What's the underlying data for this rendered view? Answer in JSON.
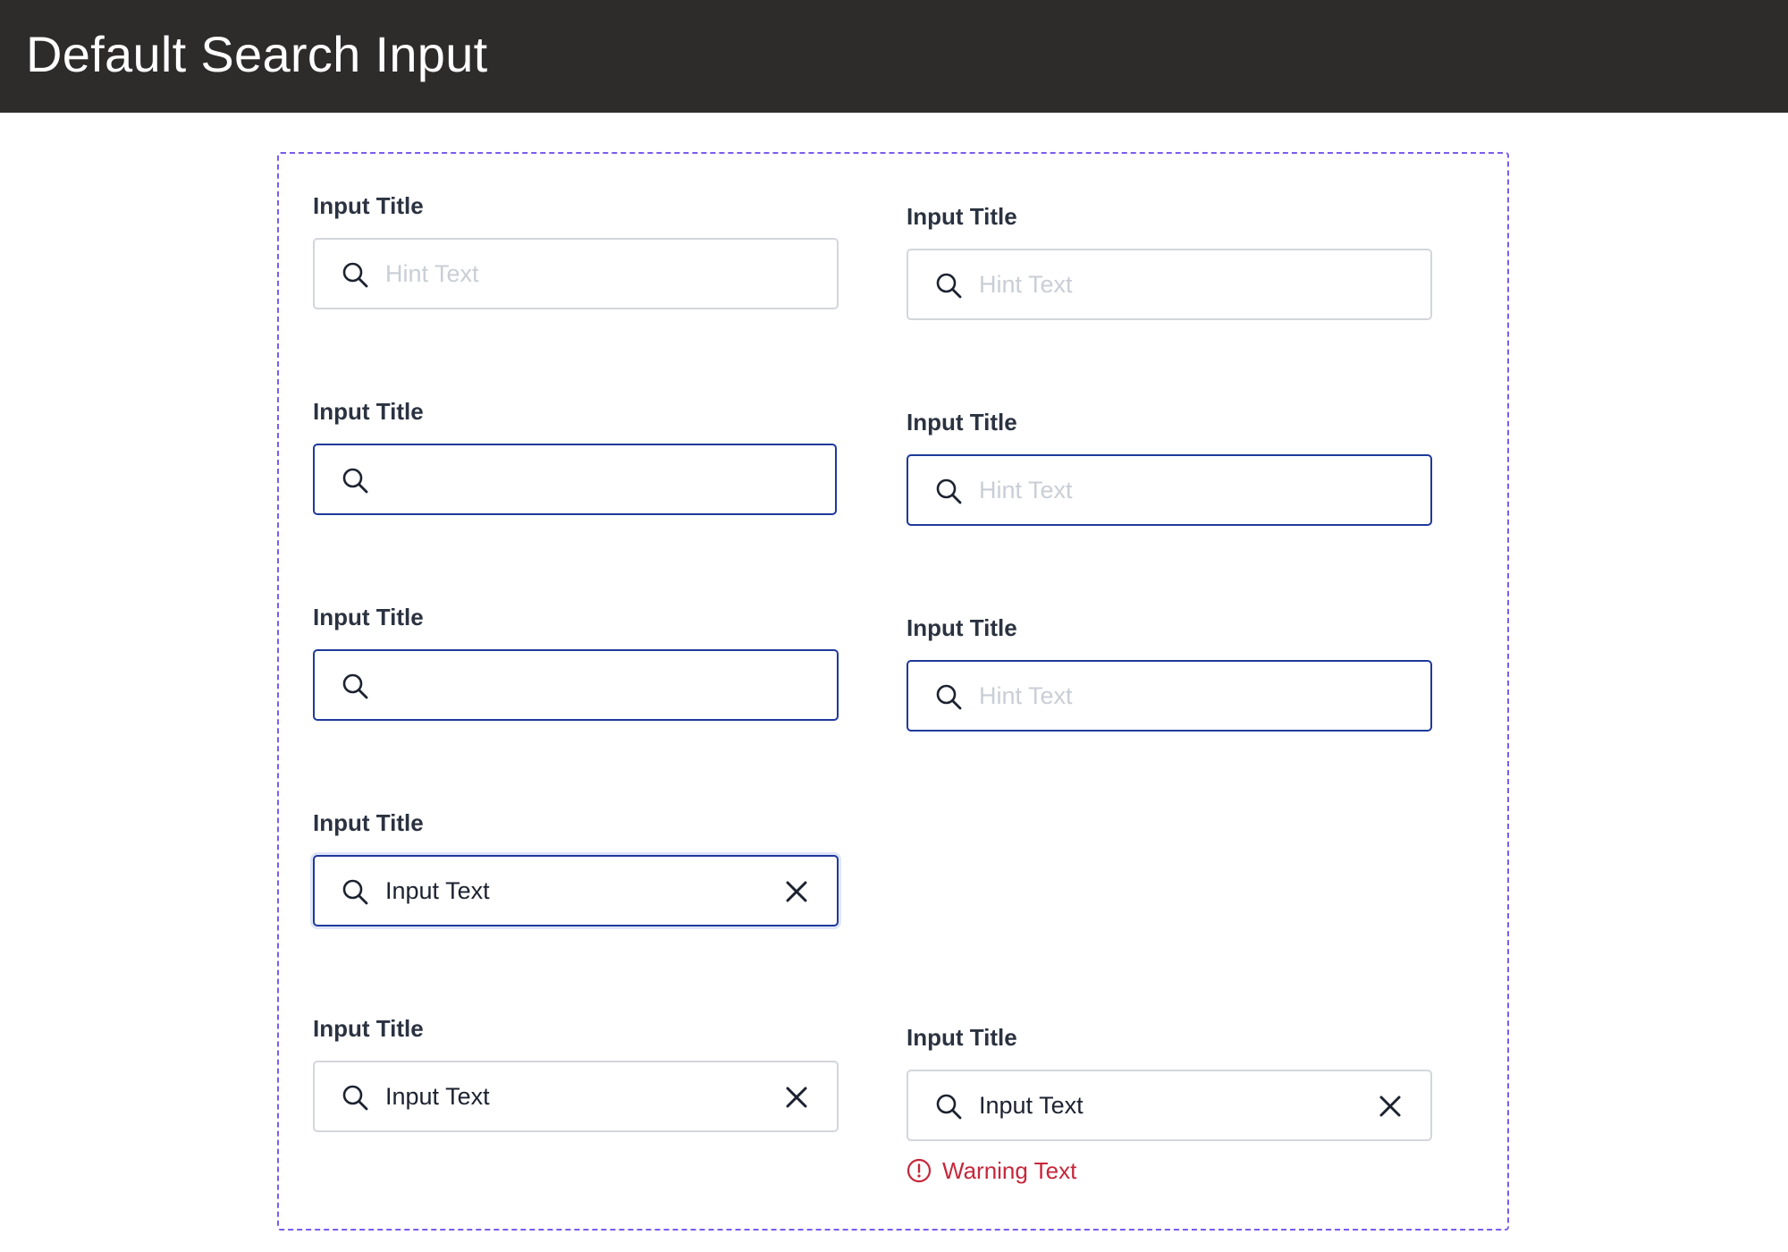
{
  "header": {
    "title": "Default Search Input"
  },
  "fields": [
    {
      "label": "Input Title",
      "text": "Hint Text",
      "kind": "hint"
    },
    {
      "label": "Input Title",
      "text": "Hint Text",
      "kind": "hint"
    },
    {
      "label": "Input Title",
      "text": "",
      "kind": "empty"
    },
    {
      "label": "Input Title",
      "text": "Hint Text",
      "kind": "hint"
    },
    {
      "label": "Input Title",
      "text": "",
      "kind": "empty"
    },
    {
      "label": "Input Title",
      "text": "Hint Text",
      "kind": "hint"
    },
    {
      "label": "Input Title",
      "text": "Input Text",
      "kind": "value"
    },
    {
      "label": "Input Title",
      "text": "Input Text",
      "kind": "value"
    },
    {
      "label": "Input Title",
      "text": "Input Text",
      "kind": "value",
      "warning": "Warning Text"
    }
  ],
  "colors": {
    "header_bg": "#2e2b2b",
    "frame_border": "#7b5cf0",
    "active_border": "#1f3a9a",
    "default_border": "#d3d6db",
    "hint_text": "#c9ced6",
    "warning": "#c6273b"
  },
  "icons": {
    "search": "search-icon",
    "clear": "close-icon",
    "warning": "alert-circle-icon"
  }
}
